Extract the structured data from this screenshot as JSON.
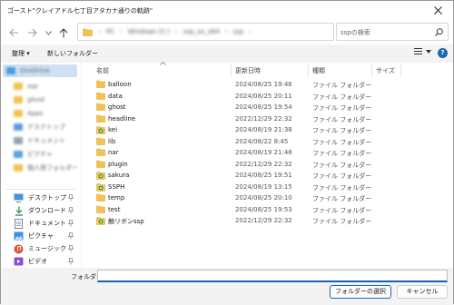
{
  "window": {
    "title": "ゴースト\"クレイアドル七丁目アタカナ通りの軌跡\""
  },
  "toolbar": {
    "address_crumbs": [
      "PC",
      "Windows (C:)",
      "ssp_xx_x64",
      "ssp"
    ],
    "search_placeholder": "sspの検索"
  },
  "commands": {
    "organize": "整理 ▾",
    "new_folder": "新しいフォルダー"
  },
  "navpane": {
    "blurred_items": [
      {
        "label": "OneDrive",
        "color": "#4a9ae0"
      },
      {
        "label": "ssp",
        "color": "#f2c14e"
      },
      {
        "label": "ghost",
        "color": "#f2c14e"
      },
      {
        "label": "Apps",
        "color": "#f2c14e"
      },
      {
        "label": "デスクトップ",
        "color": "#5a9fe0"
      },
      {
        "label": "ドキュメント",
        "color": "#9aa3ad"
      },
      {
        "label": "ピクチャ",
        "color": "#5a9fe0"
      },
      {
        "label": "個人用フォルダー",
        "color": "#f2c14e"
      }
    ],
    "quick_access": [
      {
        "label": "デスクトップ",
        "icon": "desktop-icon"
      },
      {
        "label": "ダウンロード",
        "icon": "download-icon"
      },
      {
        "label": "ドキュメント",
        "icon": "document-icon"
      },
      {
        "label": "ピクチャ",
        "icon": "picture-icon"
      },
      {
        "label": "ミュージック",
        "icon": "music-icon"
      },
      {
        "label": "ビデオ",
        "icon": "video-icon"
      }
    ]
  },
  "filelist": {
    "columns": {
      "name": "名前",
      "date": "更新日時",
      "type": "種類",
      "size": "サイズ"
    },
    "rows": [
      {
        "name": "balloon",
        "date": "2024/08/25 19:46",
        "type": "ファイル フォルダー",
        "icon": "folder-icon"
      },
      {
        "name": "data",
        "date": "2024/08/25 20:11",
        "type": "ファイル フォルダー",
        "icon": "folder-icon"
      },
      {
        "name": "ghost",
        "date": "2024/08/25 19:54",
        "type": "ファイル フォルダー",
        "icon": "folder-icon"
      },
      {
        "name": "headline",
        "date": "2022/12/29 22:32",
        "type": "ファイル フォルダー",
        "icon": "folder-icon"
      },
      {
        "name": "kei",
        "date": "2024/08/19 21:38",
        "type": "ファイル フォルダー",
        "icon": "ghost-folder-icon"
      },
      {
        "name": "lib",
        "date": "2024/08/22 8:45",
        "type": "ファイル フォルダー",
        "icon": "folder-icon"
      },
      {
        "name": "nar",
        "date": "2024/08/19 21:48",
        "type": "ファイル フォルダー",
        "icon": "folder-icon"
      },
      {
        "name": "plugin",
        "date": "2022/12/29 22:32",
        "type": "ファイル フォルダー",
        "icon": "folder-icon"
      },
      {
        "name": "sakura",
        "date": "2024/08/25 19:51",
        "type": "ファイル フォルダー",
        "icon": "ghost-folder-icon"
      },
      {
        "name": "SSPH",
        "date": "2024/08/19 13:15",
        "type": "ファイル フォルダー",
        "icon": "ghost-folder-icon"
      },
      {
        "name": "temp",
        "date": "2024/08/25 20:10",
        "type": "ファイル フォルダー",
        "icon": "folder-icon"
      },
      {
        "name": "test",
        "date": "2024/08/25 19:53",
        "type": "ファイル フォルダー",
        "icon": "folder-icon"
      },
      {
        "name": "触リボンssp",
        "date": "2022/12/29 22:32",
        "type": "ファイル フォルダー",
        "icon": "ghost-folder-icon"
      }
    ]
  },
  "bottom": {
    "folder_label": "フォルダー:",
    "folder_value": "",
    "select_button": "フォルダーの選択",
    "cancel_button": "キャンセル"
  },
  "colors": {
    "accent": "#1f63b8",
    "folder": "#f2c14e",
    "selected": "#cfe0f3"
  }
}
